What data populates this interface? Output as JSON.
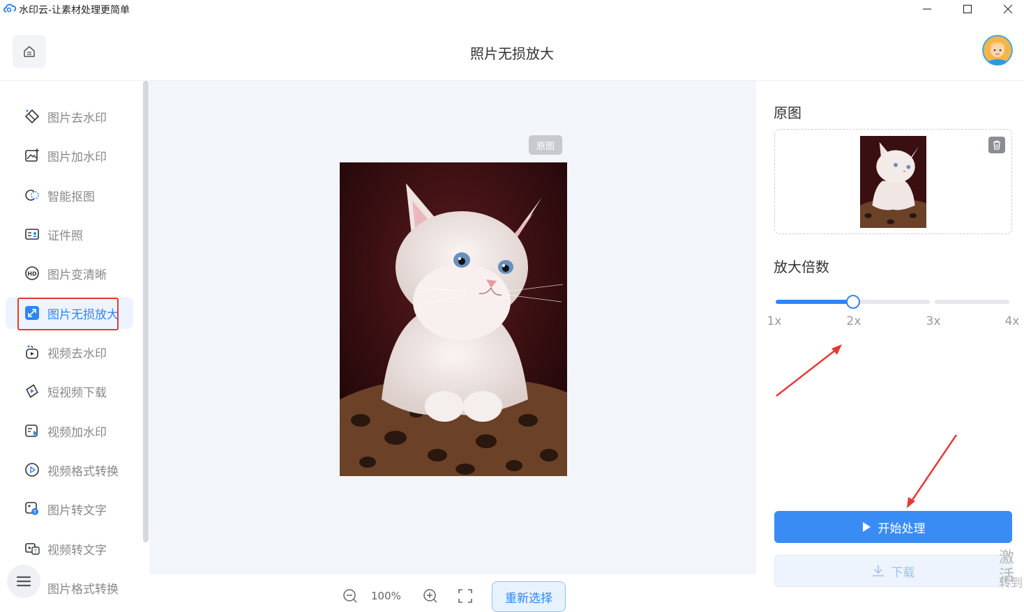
{
  "window": {
    "title": "水印云-让素材处理更简单",
    "minimize_icon": "minimize-icon",
    "maximize_icon": "maximize-icon",
    "close_icon": "close-icon"
  },
  "header": {
    "title": "照片无损放大",
    "home_icon": "home-icon",
    "avatar_icon": "avatar"
  },
  "sidebar": {
    "items": [
      {
        "label": "图片去水印",
        "icon": "eraser-icon"
      },
      {
        "label": "图片加水印",
        "icon": "image-add-icon"
      },
      {
        "label": "智能抠图",
        "icon": "cutout-icon"
      },
      {
        "label": "证件照",
        "icon": "id-card-icon"
      },
      {
        "label": "图片变清晰",
        "icon": "hd-icon"
      },
      {
        "label": "图片无损放大",
        "icon": "enlarge-icon",
        "active": true
      },
      {
        "label": "视频去水印",
        "icon": "video-eraser-icon"
      },
      {
        "label": "短视频下载",
        "icon": "video-download-icon"
      },
      {
        "label": "视频加水印",
        "icon": "video-add-icon"
      },
      {
        "label": "视频格式转换",
        "icon": "video-convert-icon"
      },
      {
        "label": "图片转文字",
        "icon": "image-text-icon"
      },
      {
        "label": "视频转文字",
        "icon": "video-text-icon"
      },
      {
        "label": "图片格式转换",
        "icon": "image-convert-icon"
      }
    ]
  },
  "canvas": {
    "badge": "原图",
    "zoom_level": "100%",
    "reselect_label": "重新选择"
  },
  "panel": {
    "original_heading": "原图",
    "scale_heading": "放大倍数",
    "scale_options": [
      "1x",
      "2x",
      "3x",
      "4x"
    ],
    "selected_scale": "2x",
    "start_label": "开始处理",
    "download_label": "下载",
    "activate_text": "激活",
    "activate_sub": "转到"
  },
  "colors": {
    "accent": "#2f85f5",
    "annotation": "#e53935"
  }
}
